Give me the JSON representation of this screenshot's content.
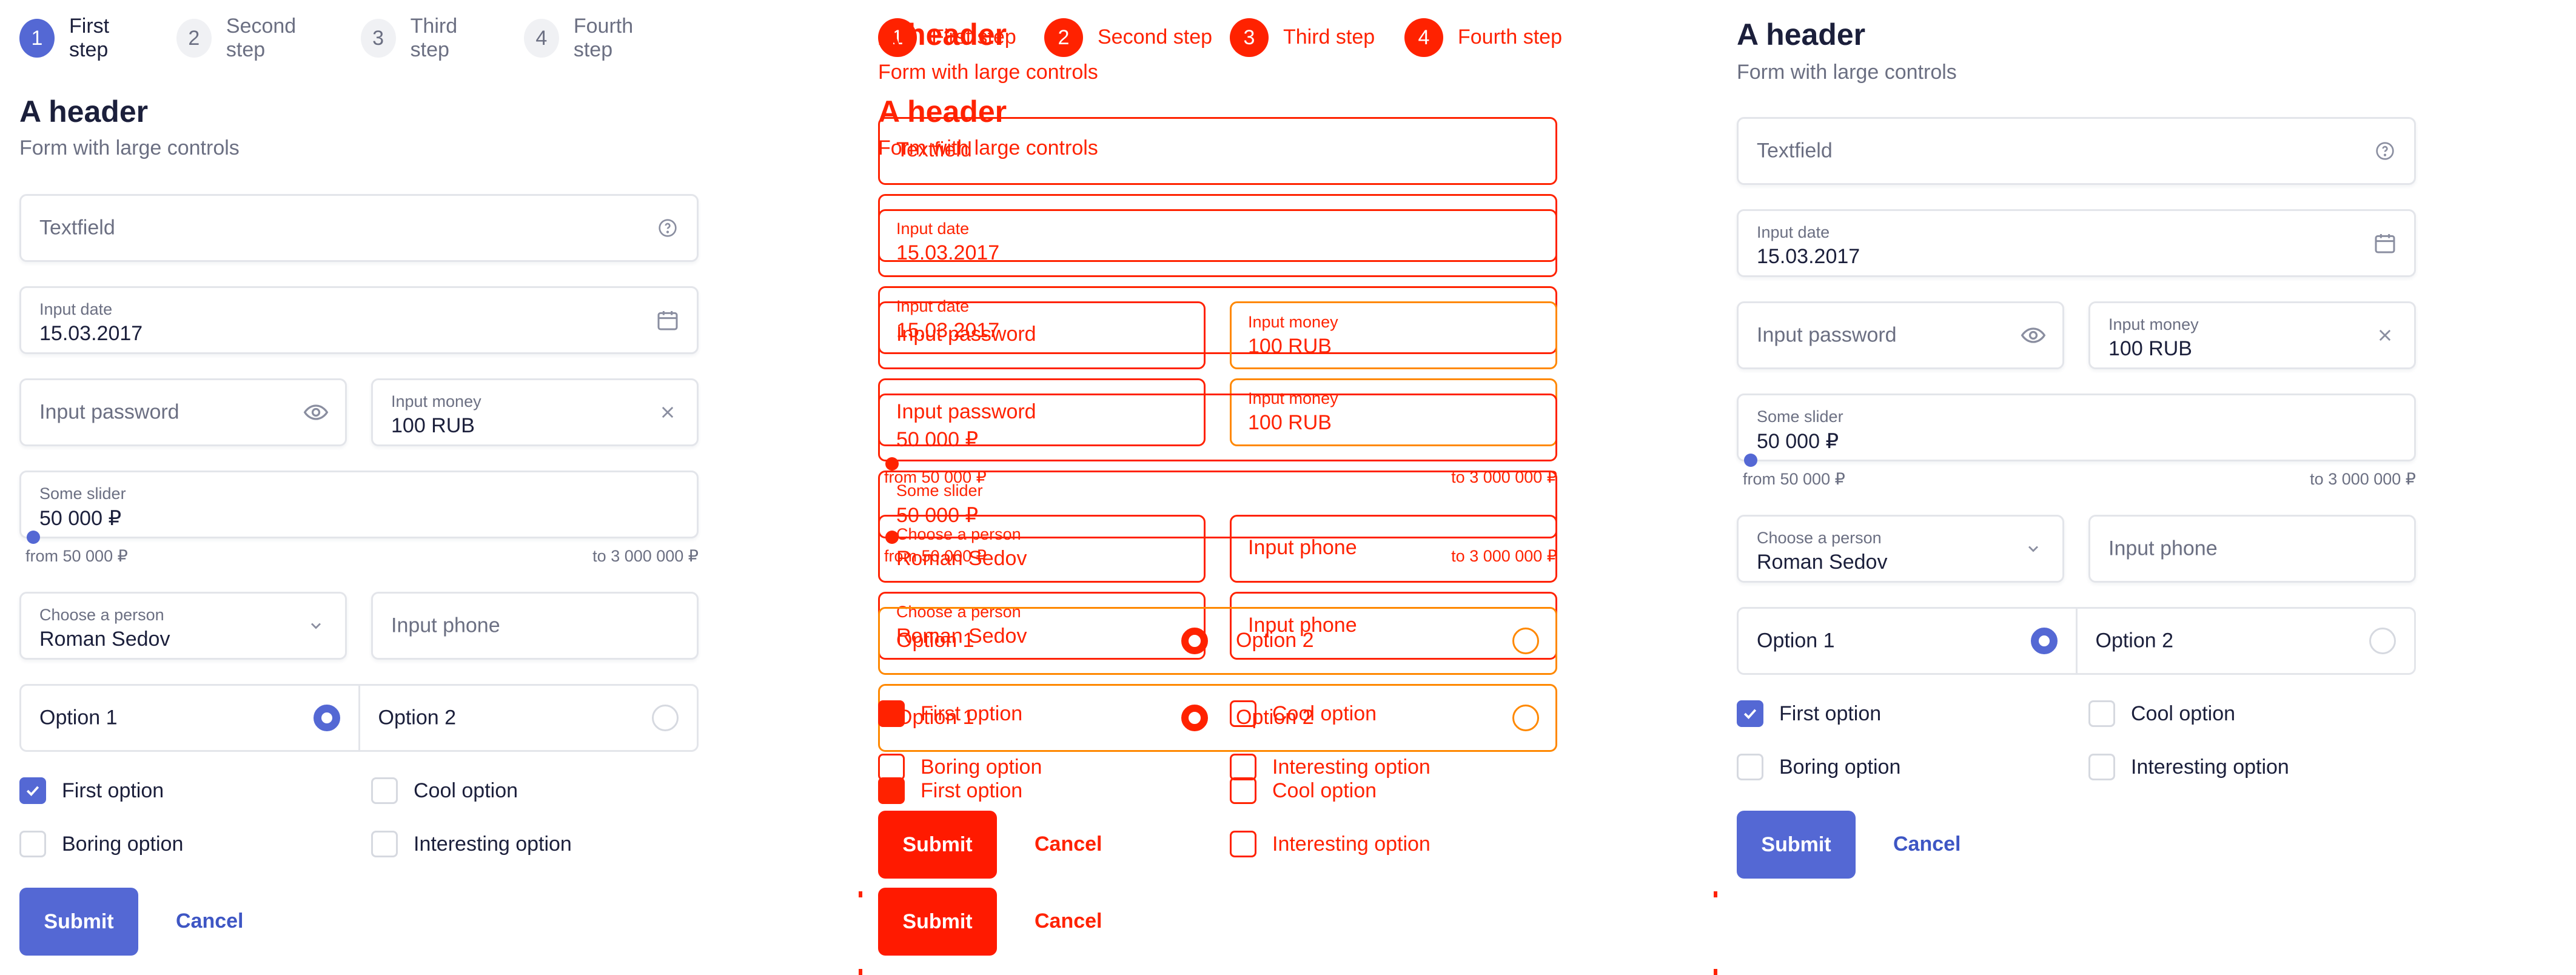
{
  "steps": [
    {
      "num": "1",
      "label": "First step"
    },
    {
      "num": "2",
      "label": "Second step"
    },
    {
      "num": "3",
      "label": "Third step"
    },
    {
      "num": "4",
      "label": "Fourth step"
    }
  ],
  "form": {
    "title": "A header",
    "subtitle": "Form with large controls",
    "textfield_placeholder": "Textfield",
    "date_label": "Input date",
    "date_value": "15.03.2017",
    "password_placeholder": "Input password",
    "money_label": "Input money",
    "money_value": "100 RUB",
    "slider_label": "Some slider",
    "slider_value": "50 000 ₽",
    "slider_min": "from 50 000 ₽",
    "slider_max": "to 3 000 000 ₽",
    "slider_fraction": 0,
    "person_label": "Choose a person",
    "person_value": "Roman Sedov",
    "phone_placeholder": "Input phone",
    "radio_options": [
      "Option 1",
      "Option 2"
    ],
    "radio_selected": 0,
    "checkboxes": [
      {
        "label": "First option",
        "checked": true
      },
      {
        "label": "Cool option",
        "checked": false
      },
      {
        "label": "Boring option",
        "checked": false
      },
      {
        "label": "Interesting option",
        "checked": false
      }
    ],
    "submit_label": "Submit",
    "cancel_label": "Cancel"
  },
  "colors": {
    "accent": "#5468d4",
    "debug_red": "#ff2200",
    "debug_orange": "#ff8800"
  },
  "icons": [
    "help-circle-icon",
    "calendar-icon",
    "eye-icon",
    "close-icon",
    "chevron-down-icon",
    "check-icon"
  ]
}
